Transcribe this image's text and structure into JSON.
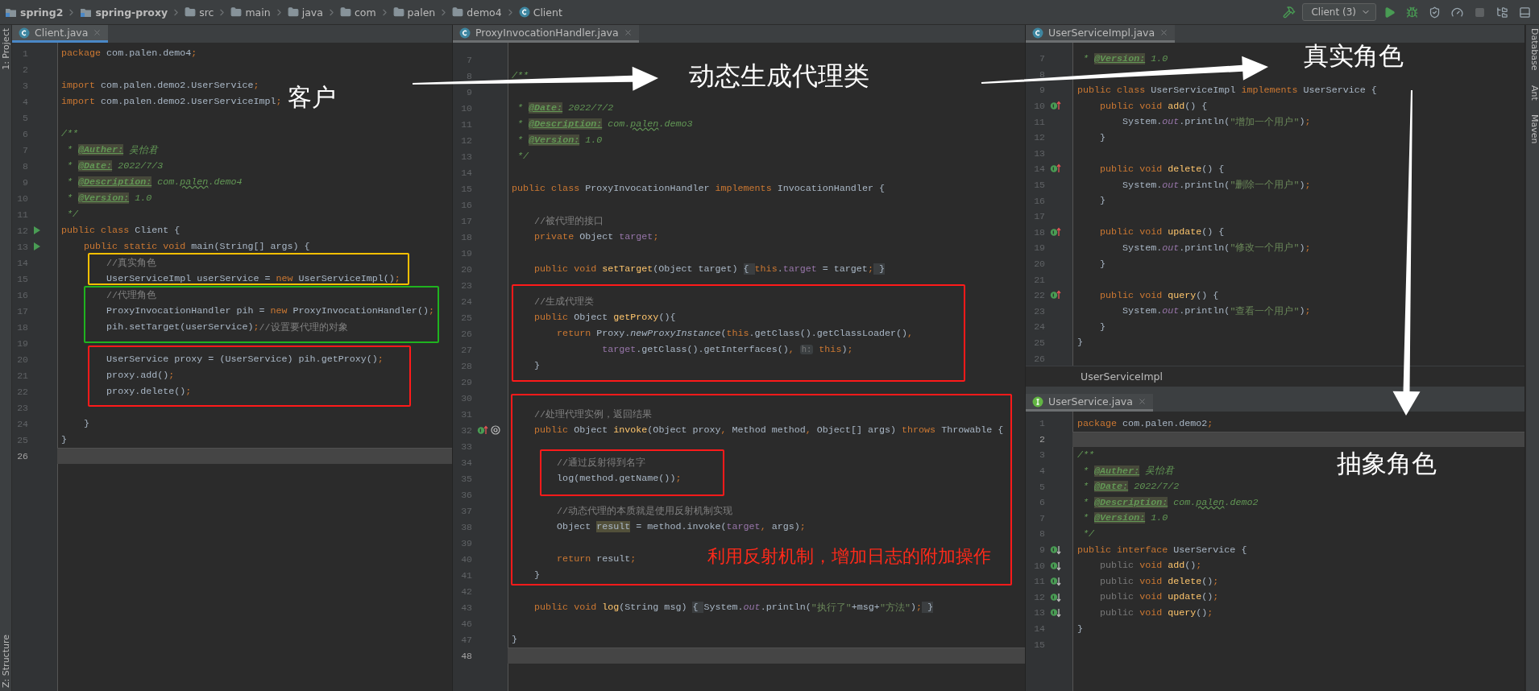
{
  "toolbar": {
    "breadcrumbs": [
      {
        "label": "spring2",
        "kind": "module"
      },
      {
        "label": "spring-proxy",
        "kind": "module"
      },
      {
        "label": "src",
        "kind": "folder"
      },
      {
        "label": "main",
        "kind": "folder"
      },
      {
        "label": "java",
        "kind": "folder"
      },
      {
        "label": "com",
        "kind": "folder"
      },
      {
        "label": "palen",
        "kind": "folder"
      },
      {
        "label": "demo4",
        "kind": "folder"
      },
      {
        "label": "Client",
        "kind": "class"
      }
    ],
    "run_config": "Client (3)"
  },
  "left_tool_windows": [
    "1: Project",
    "Z: Structure"
  ],
  "right_tool_windows": [
    "Database",
    "Ant",
    "Maven"
  ],
  "editors": [
    {
      "tab": {
        "label": "Client.java",
        "kind": "class",
        "selected": true
      },
      "lines": [
        {
          "n": "1",
          "current": false,
          "code": [
            {
              "text": "package ",
              "kind": "kw"
            },
            {
              "text": "com.palen.demo4",
              "kind": "p"
            },
            {
              "text": ";",
              "kind": "kw"
            }
          ]
        },
        {
          "n": "2",
          "current": false
        },
        {
          "n": "3",
          "current": false,
          "code": [
            {
              "text": "import ",
              "kind": "kw"
            },
            {
              "text": "com.palen.demo2.UserService",
              "kind": "p"
            },
            {
              "text": ";",
              "kind": "kw"
            }
          ]
        },
        {
          "n": "4",
          "current": false,
          "code": [
            {
              "text": "import ",
              "kind": "kw"
            },
            {
              "text": "com.palen.demo2.UserServiceImpl",
              "kind": "p"
            },
            {
              "text": ";",
              "kind": "kw"
            }
          ]
        },
        {
          "n": "5",
          "current": false
        },
        {
          "n": "6",
          "current": false,
          "code": [
            {
              "text": "/**",
              "kind": "doc"
            }
          ]
        },
        {
          "n": "7",
          "current": false,
          "code": [
            {
              "text": " * ",
              "kind": "doc"
            },
            {
              "text": "@Auther:",
              "kind": "tag"
            },
            {
              "text": " 吴怡君",
              "kind": "doc"
            }
          ]
        },
        {
          "n": "8",
          "current": false,
          "code": [
            {
              "text": " * ",
              "kind": "doc"
            },
            {
              "text": "@Date:",
              "kind": "tag"
            },
            {
              "text": " 2022/7/3",
              "kind": "doc"
            }
          ]
        },
        {
          "n": "9",
          "current": false,
          "code": [
            {
              "text": " * ",
              "kind": "doc"
            },
            {
              "text": "@Description:",
              "kind": "tag"
            },
            {
              "text": " com.",
              "kind": "doc"
            },
            {
              "text": "palen",
              "kind": "typo"
            },
            {
              "text": ".demo4",
              "kind": "doc"
            }
          ]
        },
        {
          "n": "10",
          "current": false,
          "code": [
            {
              "text": " * ",
              "kind": "doc"
            },
            {
              "text": "@Version:",
              "kind": "tag"
            },
            {
              "text": " 1.0",
              "kind": "doc"
            }
          ]
        },
        {
          "n": "11",
          "current": false,
          "code": [
            {
              "text": " */",
              "kind": "doc"
            }
          ]
        },
        {
          "n": "12",
          "current": false,
          "kind": "run",
          "code": [
            {
              "text": "public class ",
              "kind": "kw"
            },
            {
              "text": "Client {",
              "kind": "p"
            }
          ]
        },
        {
          "n": "13",
          "current": false,
          "kind": "run",
          "code": [
            {
              "text": "    public static void ",
              "kind": "kw"
            },
            {
              "text": "main(String[] args) {",
              "kind": "p"
            }
          ]
        },
        {
          "n": "14",
          "current": false,
          "code": [
            {
              "text": "        //真实角色",
              "kind": "cm"
            }
          ]
        },
        {
          "n": "15",
          "current": false,
          "code": [
            {
              "text": "        UserServiceImpl userService = ",
              "kind": "p"
            },
            {
              "text": "new ",
              "kind": "kw"
            },
            {
              "text": "UserServiceImpl()",
              "kind": "p"
            },
            {
              "text": ";",
              "kind": "kw"
            }
          ]
        },
        {
          "n": "16",
          "current": false,
          "code": [
            {
              "text": "        //代理角色",
              "kind": "cm"
            }
          ]
        },
        {
          "n": "17",
          "current": false,
          "code": [
            {
              "text": "        ProxyInvocationHandler pih = ",
              "kind": "p"
            },
            {
              "text": "new ",
              "kind": "kw"
            },
            {
              "text": "ProxyInvocationHandler()",
              "kind": "p"
            },
            {
              "text": ";",
              "kind": "kw"
            }
          ]
        },
        {
          "n": "18",
          "current": false,
          "code": [
            {
              "text": "        pih.setTarget(userService)",
              "kind": "p"
            },
            {
              "text": ";",
              "kind": "kw"
            },
            {
              "text": "//设置要代理的对象",
              "kind": "cm"
            }
          ]
        },
        {
          "n": "19",
          "current": false
        },
        {
          "n": "20",
          "current": false,
          "code": [
            {
              "text": "        UserService proxy = (UserService) pih.getProxy()",
              "kind": "p"
            },
            {
              "text": ";",
              "kind": "kw"
            }
          ]
        },
        {
          "n": "21",
          "current": false,
          "code": [
            {
              "text": "        proxy.add()",
              "kind": "p"
            },
            {
              "text": ";",
              "kind": "kw"
            }
          ]
        },
        {
          "n": "22",
          "current": false,
          "code": [
            {
              "text": "        proxy.delete()",
              "kind": "p"
            },
            {
              "text": ";",
              "kind": "kw"
            }
          ]
        },
        {
          "n": "23",
          "current": false
        },
        {
          "n": "24",
          "current": false,
          "code": [
            {
              "text": "    }",
              "kind": "p"
            }
          ]
        },
        {
          "n": "25",
          "current": false,
          "code": [
            {
              "text": "}",
              "kind": "p"
            }
          ]
        },
        {
          "n": "26",
          "current": true
        }
      ]
    },
    {
      "tab": {
        "label": "ProxyInvocationHandler.java",
        "kind": "class",
        "selected": false
      },
      "lines": [
        {
          "n": "7",
          "current": false
        },
        {
          "n": "8",
          "current": false,
          "code": [
            {
              "text": "/**",
              "kind": "doc"
            }
          ]
        },
        {
          "n": "9",
          "current": false
        },
        {
          "n": "10",
          "current": false,
          "code": [
            {
              "text": " * ",
              "kind": "doc"
            },
            {
              "text": "@Date:",
              "kind": "tag"
            },
            {
              "text": " 2022/7/2",
              "kind": "doc"
            }
          ]
        },
        {
          "n": "11",
          "current": false,
          "code": [
            {
              "text": " * ",
              "kind": "doc"
            },
            {
              "text": "@Description:",
              "kind": "tag"
            },
            {
              "text": " com.",
              "kind": "doc"
            },
            {
              "text": "palen",
              "kind": "typo"
            },
            {
              "text": ".demo3",
              "kind": "doc"
            }
          ]
        },
        {
          "n": "12",
          "current": false,
          "code": [
            {
              "text": " * ",
              "kind": "doc"
            },
            {
              "text": "@Version:",
              "kind": "tag"
            },
            {
              "text": " 1.0",
              "kind": "doc"
            }
          ]
        },
        {
          "n": "13",
          "current": false,
          "code": [
            {
              "text": " */",
              "kind": "doc"
            }
          ]
        },
        {
          "n": "14",
          "current": false
        },
        {
          "n": "15",
          "current": false,
          "code": [
            {
              "text": "public class ",
              "kind": "kw"
            },
            {
              "text": "ProxyInvocationHandler ",
              "kind": "p"
            },
            {
              "text": "implements ",
              "kind": "kw"
            },
            {
              "text": "InvocationHandler {",
              "kind": "p"
            }
          ]
        },
        {
          "n": "16",
          "current": false
        },
        {
          "n": "17",
          "current": false,
          "code": [
            {
              "text": "    //被代理的接口",
              "kind": "cm"
            }
          ]
        },
        {
          "n": "18",
          "current": false,
          "code": [
            {
              "text": "    private ",
              "kind": "kw"
            },
            {
              "text": "Object ",
              "kind": "p"
            },
            {
              "text": "target",
              "kind": "fld"
            },
            {
              "text": ";",
              "kind": "kw"
            }
          ]
        },
        {
          "n": "19",
          "current": false
        },
        {
          "n": "20",
          "current": false,
          "code": [
            {
              "text": "    public void ",
              "kind": "kw"
            },
            {
              "text": "setTarget",
              "kind": "fn"
            },
            {
              "text": "(Object target) ",
              "kind": "p"
            },
            {
              "text": "{ ",
              "kind": "fold"
            },
            {
              "text": "this",
              "kind": "kw"
            },
            {
              "text": ".",
              "kind": "p"
            },
            {
              "text": "target",
              "kind": "fld"
            },
            {
              "text": " = target",
              "kind": "p"
            },
            {
              "text": ";",
              "kind": "kw"
            },
            {
              "text": " }",
              "kind": "fold"
            }
          ]
        },
        {
          "n": "23",
          "current": false
        },
        {
          "n": "24",
          "current": false,
          "code": [
            {
              "text": "    //生成代理类",
              "kind": "cm"
            }
          ]
        },
        {
          "n": "25",
          "current": false,
          "code": [
            {
              "text": "    public ",
              "kind": "kw"
            },
            {
              "text": "Object ",
              "kind": "p"
            },
            {
              "text": "getProxy",
              "kind": "fn"
            },
            {
              "text": "(){",
              "kind": "p"
            }
          ]
        },
        {
          "n": "26",
          "current": false,
          "code": [
            {
              "text": "        return ",
              "kind": "kw"
            },
            {
              "text": "Proxy.",
              "kind": "p"
            },
            {
              "text": "newProxyInstance",
              "kind": "sfn"
            },
            {
              "text": "(",
              "kind": "p"
            },
            {
              "text": "this",
              "kind": "kw"
            },
            {
              "text": ".getClass().getClassLoader()",
              "kind": "p"
            },
            {
              "text": ",",
              "kind": "kw"
            }
          ]
        },
        {
          "n": "27",
          "current": false,
          "code": [
            {
              "text": "                target",
              "kind": "fld"
            },
            {
              "text": ".getClass().getInterfaces()",
              "kind": "p"
            },
            {
              "text": ", ",
              "kind": "kw"
            },
            {
              "text": "h:",
              "kind": "hint"
            },
            {
              "text": " this",
              "kind": "kw"
            },
            {
              "text": ")",
              "kind": "p"
            },
            {
              "text": ";",
              "kind": "kw"
            }
          ]
        },
        {
          "n": "28",
          "current": false,
          "code": [
            {
              "text": "    }",
              "kind": "p"
            }
          ]
        },
        {
          "n": "29",
          "current": false
        },
        {
          "n": "30",
          "current": false
        },
        {
          "n": "31",
          "current": false,
          "code": [
            {
              "text": "    //处理代理实例，返回结果",
              "kind": "cm"
            }
          ]
        },
        {
          "n": "32",
          "current": false,
          "kind": "override_at",
          "code": [
            {
              "text": "    public ",
              "kind": "kw"
            },
            {
              "text": "Object ",
              "kind": "p"
            },
            {
              "text": "invoke",
              "kind": "fn"
            },
            {
              "text": "(Object proxy",
              "kind": "p"
            },
            {
              "text": ", ",
              "kind": "kw"
            },
            {
              "text": "Method method",
              "kind": "p"
            },
            {
              "text": ", ",
              "kind": "kw"
            },
            {
              "text": "Object[] args) ",
              "kind": "p"
            },
            {
              "text": "throws ",
              "kind": "kw"
            },
            {
              "text": "Throwable {",
              "kind": "p"
            }
          ]
        },
        {
          "n": "33",
          "current": false
        },
        {
          "n": "34",
          "current": false,
          "code": [
            {
              "text": "        //通过反射得到名字",
              "kind": "cm"
            }
          ]
        },
        {
          "n": "35",
          "current": false,
          "code": [
            {
              "text": "        log(method.getName())",
              "kind": "p"
            },
            {
              "text": ";",
              "kind": "kw"
            }
          ]
        },
        {
          "n": "36",
          "current": false
        },
        {
          "n": "37",
          "current": false,
          "code": [
            {
              "text": "        //动态代理的本质就是使用反射机制实现",
              "kind": "cm"
            }
          ]
        },
        {
          "n": "38",
          "current": false,
          "code": [
            {
              "text": "        Object ",
              "kind": "p"
            },
            {
              "text": "result",
              "kind": "sel"
            },
            {
              "text": " = method.invoke(",
              "kind": "p"
            },
            {
              "text": "target",
              "kind": "fld"
            },
            {
              "text": ", ",
              "kind": "kw"
            },
            {
              "text": "args)",
              "kind": "p"
            },
            {
              "text": ";",
              "kind": "kw"
            }
          ]
        },
        {
          "n": "39",
          "current": false
        },
        {
          "n": "40",
          "current": false,
          "code": [
            {
              "text": "        return ",
              "kind": "kw"
            },
            {
              "text": "result",
              "kind": "p"
            },
            {
              "text": ";",
              "kind": "kw"
            }
          ]
        },
        {
          "n": "41",
          "current": false,
          "code": [
            {
              "text": "    }",
              "kind": "p"
            }
          ]
        },
        {
          "n": "42",
          "current": false
        },
        {
          "n": "43",
          "current": false,
          "code": [
            {
              "text": "    public void ",
              "kind": "kw"
            },
            {
              "text": "log",
              "kind": "fn"
            },
            {
              "text": "(String msg) ",
              "kind": "p"
            },
            {
              "text": "{ ",
              "kind": "fold"
            },
            {
              "text": "System.",
              "kind": "p"
            },
            {
              "text": "out",
              "kind": "sfld"
            },
            {
              "text": ".println(",
              "kind": "p"
            },
            {
              "text": "\"执行了\"",
              "kind": "str"
            },
            {
              "text": "+msg+",
              "kind": "p"
            },
            {
              "text": "\"方法\"",
              "kind": "str"
            },
            {
              "text": ")",
              "kind": "p"
            },
            {
              "text": ";",
              "kind": "kw"
            },
            {
              "text": " }",
              "kind": "fold"
            }
          ]
        },
        {
          "n": "46",
          "current": false
        },
        {
          "n": "47",
          "current": false,
          "code": [
            {
              "text": "}",
              "kind": "p"
            }
          ]
        },
        {
          "n": "48",
          "current": true
        }
      ]
    },
    {
      "tab": {
        "label": "UserServiceImpl.java",
        "kind": "class",
        "selected": false
      },
      "footer": "UserServiceImpl",
      "lines": [
        {
          "n": "7",
          "current": false,
          "code": [
            {
              "text": " * ",
              "kind": "doc"
            },
            {
              "text": "@Version:",
              "kind": "tag"
            },
            {
              "text": " 1.0",
              "kind": "doc"
            }
          ]
        },
        {
          "n": "8",
          "current": false
        },
        {
          "n": "9",
          "current": false,
          "code": [
            {
              "text": "public class ",
              "kind": "kw"
            },
            {
              "text": "UserServiceImpl ",
              "kind": "p"
            },
            {
              "text": "implements ",
              "kind": "kw"
            },
            {
              "text": "UserService {",
              "kind": "p"
            }
          ]
        },
        {
          "n": "10",
          "current": false,
          "kind": "implements",
          "code": [
            {
              "text": "    public void ",
              "kind": "kw"
            },
            {
              "text": "add",
              "kind": "fn"
            },
            {
              "text": "() {",
              "kind": "p"
            }
          ]
        },
        {
          "n": "11",
          "current": false,
          "code": [
            {
              "text": "        System.",
              "kind": "p"
            },
            {
              "text": "out",
              "kind": "sfld"
            },
            {
              "text": ".println(",
              "kind": "p"
            },
            {
              "text": "\"增加一个用户\"",
              "kind": "str"
            },
            {
              "text": ")",
              "kind": "p"
            },
            {
              "text": ";",
              "kind": "kw"
            }
          ]
        },
        {
          "n": "12",
          "current": false,
          "code": [
            {
              "text": "    }",
              "kind": "p"
            }
          ]
        },
        {
          "n": "13",
          "current": false
        },
        {
          "n": "14",
          "current": false,
          "kind": "implements",
          "code": [
            {
              "text": "    public void ",
              "kind": "kw"
            },
            {
              "text": "delete",
              "kind": "fn"
            },
            {
              "text": "() {",
              "kind": "p"
            }
          ]
        },
        {
          "n": "15",
          "current": false,
          "code": [
            {
              "text": "        System.",
              "kind": "p"
            },
            {
              "text": "out",
              "kind": "sfld"
            },
            {
              "text": ".println(",
              "kind": "p"
            },
            {
              "text": "\"删除一个用户\"",
              "kind": "str"
            },
            {
              "text": ")",
              "kind": "p"
            },
            {
              "text": ";",
              "kind": "kw"
            }
          ]
        },
        {
          "n": "16",
          "current": false,
          "code": [
            {
              "text": "    }",
              "kind": "p"
            }
          ]
        },
        {
          "n": "17",
          "current": false
        },
        {
          "n": "18",
          "current": false,
          "kind": "implements",
          "code": [
            {
              "text": "    public void ",
              "kind": "kw"
            },
            {
              "text": "update",
              "kind": "fn"
            },
            {
              "text": "() {",
              "kind": "p"
            }
          ]
        },
        {
          "n": "19",
          "current": false,
          "code": [
            {
              "text": "        System.",
              "kind": "p"
            },
            {
              "text": "out",
              "kind": "sfld"
            },
            {
              "text": ".println(",
              "kind": "p"
            },
            {
              "text": "\"修改一个用户\"",
              "kind": "str"
            },
            {
              "text": ")",
              "kind": "p"
            },
            {
              "text": ";",
              "kind": "kw"
            }
          ]
        },
        {
          "n": "20",
          "current": false,
          "code": [
            {
              "text": "    }",
              "kind": "p"
            }
          ]
        },
        {
          "n": "21",
          "current": false
        },
        {
          "n": "22",
          "current": false,
          "kind": "implements",
          "code": [
            {
              "text": "    public void ",
              "kind": "kw"
            },
            {
              "text": "query",
              "kind": "fn"
            },
            {
              "text": "() {",
              "kind": "p"
            }
          ]
        },
        {
          "n": "23",
          "current": false,
          "code": [
            {
              "text": "        System.",
              "kind": "p"
            },
            {
              "text": "out",
              "kind": "sfld"
            },
            {
              "text": ".println(",
              "kind": "p"
            },
            {
              "text": "\"查看一个用户\"",
              "kind": "str"
            },
            {
              "text": ")",
              "kind": "p"
            },
            {
              "text": ";",
              "kind": "kw"
            }
          ]
        },
        {
          "n": "24",
          "current": false,
          "code": [
            {
              "text": "    }",
              "kind": "p"
            }
          ]
        },
        {
          "n": "25",
          "current": false,
          "code": [
            {
              "text": "}",
              "kind": "p"
            }
          ]
        },
        {
          "n": "26",
          "current": false
        }
      ]
    },
    {
      "tab": {
        "label": "UserService.java",
        "kind": "interface",
        "selected": false
      },
      "lines": [
        {
          "n": "1",
          "current": false,
          "code": [
            {
              "text": "package ",
              "kind": "kw"
            },
            {
              "text": "com.palen.demo2",
              "kind": "p"
            },
            {
              "text": ";",
              "kind": "kw"
            }
          ]
        },
        {
          "n": "2",
          "current": true
        },
        {
          "n": "3",
          "current": false,
          "code": [
            {
              "text": "/**",
              "kind": "doc"
            }
          ]
        },
        {
          "n": "4",
          "current": false,
          "code": [
            {
              "text": " * ",
              "kind": "doc"
            },
            {
              "text": "@Auther:",
              "kind": "tag"
            },
            {
              "text": " 吴怡君",
              "kind": "doc"
            }
          ]
        },
        {
          "n": "5",
          "current": false,
          "code": [
            {
              "text": " * ",
              "kind": "doc"
            },
            {
              "text": "@Date:",
              "kind": "tag"
            },
            {
              "text": " 2022/7/2",
              "kind": "doc"
            }
          ]
        },
        {
          "n": "6",
          "current": false,
          "code": [
            {
              "text": " * ",
              "kind": "doc"
            },
            {
              "text": "@Description:",
              "kind": "tag"
            },
            {
              "text": " com.",
              "kind": "doc"
            },
            {
              "text": "palen",
              "kind": "typo"
            },
            {
              "text": ".demo2",
              "kind": "doc"
            }
          ]
        },
        {
          "n": "7",
          "current": false,
          "code": [
            {
              "text": " * ",
              "kind": "doc"
            },
            {
              "text": "@Version:",
              "kind": "tag"
            },
            {
              "text": " 1.0",
              "kind": "doc"
            }
          ]
        },
        {
          "n": "8",
          "current": false,
          "code": [
            {
              "text": " */",
              "kind": "doc"
            }
          ]
        },
        {
          "n": "9",
          "current": false,
          "kind": "implemented",
          "code": [
            {
              "text": "public interface ",
              "kind": "kw"
            },
            {
              "text": "UserService {",
              "kind": "p"
            }
          ]
        },
        {
          "n": "10",
          "current": false,
          "kind": "implemented",
          "code": [
            {
              "text": "    public ",
              "kind": "dim"
            },
            {
              "text": "void ",
              "kind": "kw"
            },
            {
              "text": "add",
              "kind": "fn"
            },
            {
              "text": "()",
              "kind": "p"
            },
            {
              "text": ";",
              "kind": "kw"
            }
          ]
        },
        {
          "n": "11",
          "current": false,
          "kind": "implemented",
          "code": [
            {
              "text": "    public ",
              "kind": "dim"
            },
            {
              "text": "void ",
              "kind": "kw"
            },
            {
              "text": "delete",
              "kind": "fn"
            },
            {
              "text": "()",
              "kind": "p"
            },
            {
              "text": ";",
              "kind": "kw"
            }
          ]
        },
        {
          "n": "12",
          "current": false,
          "kind": "implemented",
          "code": [
            {
              "text": "    public ",
              "kind": "dim"
            },
            {
              "text": "void ",
              "kind": "kw"
            },
            {
              "text": "update",
              "kind": "fn"
            },
            {
              "text": "()",
              "kind": "p"
            },
            {
              "text": ";",
              "kind": "kw"
            }
          ]
        },
        {
          "n": "13",
          "current": false,
          "kind": "implemented",
          "code": [
            {
              "text": "    public ",
              "kind": "dim"
            },
            {
              "text": "void ",
              "kind": "kw"
            },
            {
              "text": "query",
              "kind": "fn"
            },
            {
              "text": "()",
              "kind": "p"
            },
            {
              "text": ";",
              "kind": "kw"
            }
          ]
        },
        {
          "n": "14",
          "current": false,
          "code": [
            {
              "text": "}",
              "kind": "p"
            }
          ]
        },
        {
          "n": "15",
          "current": false
        }
      ]
    }
  ],
  "annotations": {
    "labels": [
      {
        "text": "客户",
        "color": "#ffffff"
      },
      {
        "text": "动态生成代理类",
        "color": "#ffffff"
      },
      {
        "text": "真实角色",
        "color": "#ffffff"
      },
      {
        "text": "抽象角色",
        "color": "#ffffff"
      },
      {
        "text": "利用反射机制，增加日志的附加操作",
        "color": "#ff2a1a"
      }
    ],
    "boxes": [
      {
        "color": "#ffc000"
      },
      {
        "color": "#1fb31f"
      },
      {
        "color": "#ff1a1a"
      },
      {
        "color": "#ff1a1a"
      },
      {
        "color": "#ff1a1a"
      },
      {
        "color": "#ff1a1a"
      }
    ]
  }
}
